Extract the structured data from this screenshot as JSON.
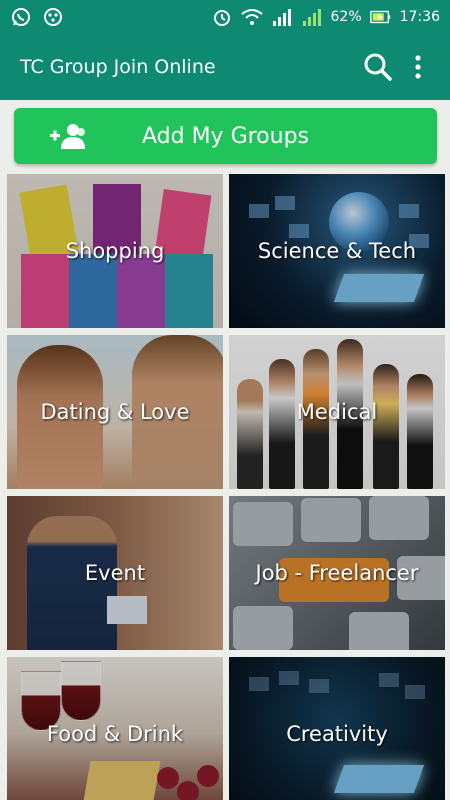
{
  "status_bar": {
    "battery": "62%",
    "time": "17:36",
    "icons": [
      "whatsapp-icon",
      "notification-icon",
      "alarm-icon",
      "wifi-icon",
      "signal-icon",
      "signal-icon",
      "battery-charging-icon"
    ]
  },
  "app_bar": {
    "title": "TC Group Join Online",
    "icons": [
      "search-icon",
      "more-vert-icon"
    ]
  },
  "add_button": {
    "label": "Add My Groups",
    "icon": "add-group-icon",
    "color": "#21c45a"
  },
  "categories": [
    {
      "label": "Shopping"
    },
    {
      "label": "Science & Tech"
    },
    {
      "label": "Dating & Love"
    },
    {
      "label": "Medical"
    },
    {
      "label": "Event"
    },
    {
      "label": "Job - Freelancer"
    },
    {
      "label": "Food & Drink"
    },
    {
      "label": "Creativity"
    }
  ],
  "colors": {
    "primary": "#0e8a73",
    "accent": "#21c45a"
  }
}
